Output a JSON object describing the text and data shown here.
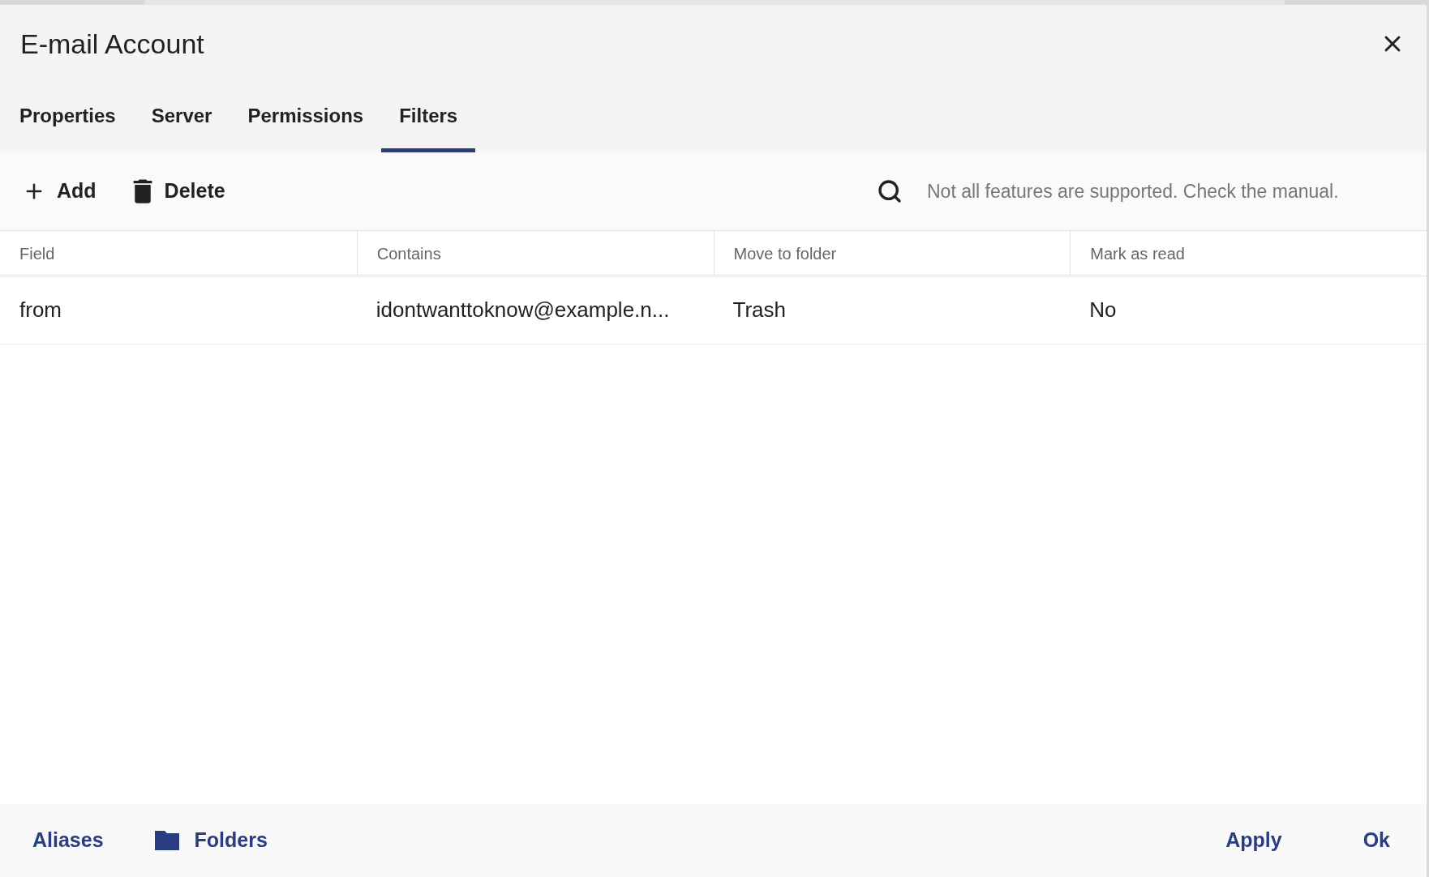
{
  "dialog": {
    "title": "E-mail Account"
  },
  "tabs": [
    {
      "label": "Properties",
      "selected": false
    },
    {
      "label": "Server",
      "selected": false
    },
    {
      "label": "Permissions",
      "selected": false
    },
    {
      "label": "Filters",
      "selected": true
    }
  ],
  "toolbar": {
    "buttons": [
      {
        "label": "Add",
        "kind": "add"
      },
      {
        "label": "Delete",
        "kind": "delete"
      }
    ],
    "search": {
      "placeholder": "Not all features are supported. Check the manual."
    }
  },
  "table": {
    "columns": [
      "Field",
      "Contains",
      "Move to folder",
      "Mark as read"
    ],
    "rows": [
      [
        "from",
        "idontwanttoknow@example.n...",
        "Trash",
        "No"
      ]
    ]
  },
  "footer": {
    "left": [
      {
        "label": "Aliases",
        "kind": "plain"
      },
      {
        "label": "Folders",
        "kind": "folder"
      }
    ],
    "right": [
      "Apply",
      "Ok"
    ]
  }
}
